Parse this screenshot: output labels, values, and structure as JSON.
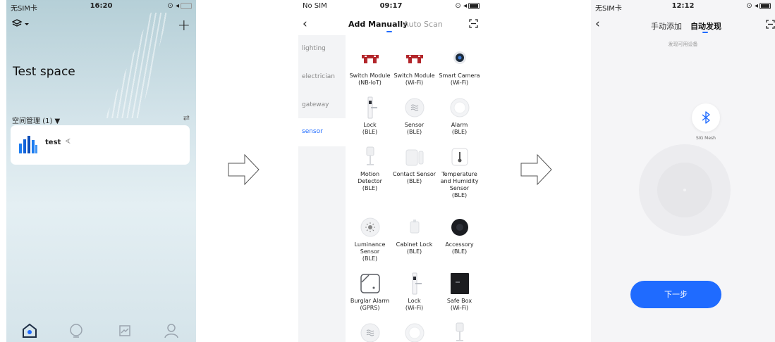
{
  "screen1": {
    "status": {
      "carrier": "无SIM卡",
      "time": "16:20"
    },
    "space_title": "Test space",
    "management_label": "空间管理 (1) ▼",
    "home": {
      "name": "test",
      "location_glyph": "∢"
    },
    "icons": {
      "layers": "layers-icon",
      "add": "+",
      "filter": "⇄"
    }
  },
  "screen2": {
    "status": {
      "carrier": "No SIM",
      "time": "09:17"
    },
    "back": "‹",
    "tabs": [
      "Add Manually",
      "Auto Scan"
    ],
    "categories": [
      "lighting",
      "electrician",
      "gateway",
      "sensor"
    ],
    "active_category": "sensor",
    "devices": [
      {
        "name": "Switch Module (NB-IoT)",
        "lines": [
          "Switch Module",
          "(NB-IoT)"
        ],
        "icon": "switch-module-icon"
      },
      {
        "name": "Switch Module (Wi-Fi)",
        "lines": [
          "Switch Module",
          "(Wi-Fi)"
        ],
        "icon": "switch-module-icon"
      },
      {
        "name": "Smart Camera (Wi-Fi)",
        "lines": [
          "Smart Camera",
          "(Wi-Fi)"
        ],
        "icon": "camera-icon"
      },
      {
        "name": "Lock (BLE)",
        "lines": [
          "Lock",
          "(BLE)"
        ],
        "icon": "lock-icon"
      },
      {
        "name": "Sensor (BLE)",
        "lines": [
          "Sensor",
          "(BLE)"
        ],
        "icon": "sensor-icon"
      },
      {
        "name": "Alarm (BLE)",
        "lines": [
          "Alarm",
          "(BLE)"
        ],
        "icon": "alarm-icon"
      },
      {
        "name": "Motion Detector (BLE)",
        "lines": [
          "Motion Detector",
          "(BLE)"
        ],
        "icon": "motion-detector-icon"
      },
      {
        "name": "Contact Sensor (BLE)",
        "lines": [
          "Contact Sensor",
          "(BLE)"
        ],
        "icon": "contact-sensor-icon"
      },
      {
        "name": "Temperature and Humidity Sensor (BLE)",
        "lines": [
          "Temperature",
          "and Humidity",
          "Sensor",
          "(BLE)"
        ],
        "icon": "thermometer-icon"
      },
      {
        "name": "Luminance Sensor (BLE)",
        "lines": [
          "Luminance",
          "Sensor",
          "(BLE)"
        ],
        "icon": "luminance-sensor-icon"
      },
      {
        "name": "Cabinet Lock (BLE)",
        "lines": [
          "Cabinet Lock",
          "(BLE)"
        ],
        "icon": "cabinet-lock-icon"
      },
      {
        "name": "Accessory (BLE)",
        "lines": [
          "Accessory",
          "(BLE)"
        ],
        "icon": "accessory-icon"
      },
      {
        "name": "Burglar Alarm (GPRS)",
        "lines": [
          "Burglar Alarm",
          "(GPRS)"
        ],
        "icon": "burglar-alarm-icon"
      },
      {
        "name": "Lock (Wi-Fi)",
        "lines": [
          "Lock",
          "(Wi-Fi)"
        ],
        "icon": "lock-icon"
      },
      {
        "name": "Safe Box (Wi-Fi)",
        "lines": [
          "Safe Box",
          "(Wi-Fi)"
        ],
        "icon": "safe-box-icon"
      },
      {
        "name": "",
        "lines": [],
        "icon": "sensor-icon"
      },
      {
        "name": "",
        "lines": [],
        "icon": "alarm-icon"
      },
      {
        "name": "",
        "lines": [],
        "icon": "motion-detector-icon"
      }
    ]
  },
  "screen3": {
    "status": {
      "carrier": "无SIM卡",
      "time": "12:12"
    },
    "back": "‹",
    "tabs": [
      "手动添加",
      "自动发现"
    ],
    "subtitle": "发现可用设备",
    "device_label": "SIG Mesh",
    "next_button": "下一步"
  },
  "colors": {
    "accent": "#1f6bff",
    "sidebar_bg": "#f3f4f6",
    "lock_red": "#b3262b"
  }
}
